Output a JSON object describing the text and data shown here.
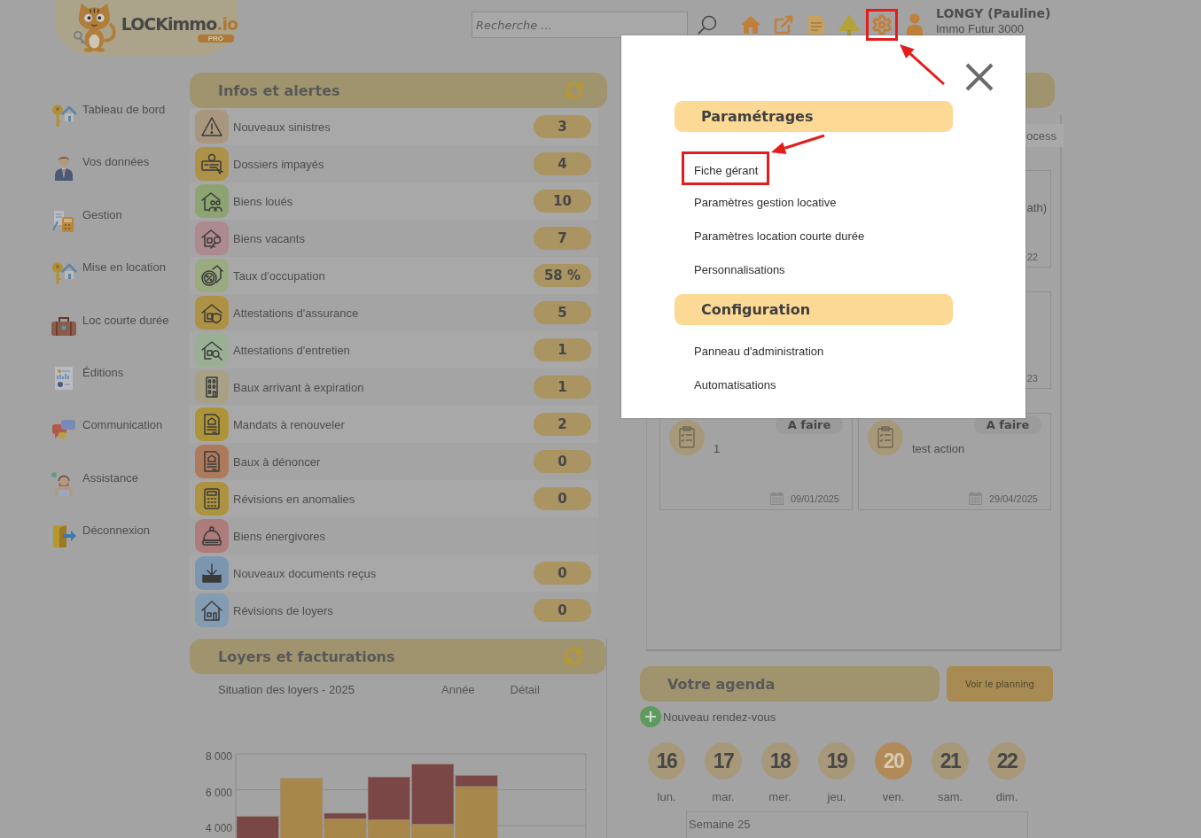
{
  "header": {
    "logo": {
      "wordmark": "LOCKimmo",
      "suffix": ".io",
      "badge": "PRO"
    },
    "search": {
      "placeholder": "Recherche ..."
    },
    "toolbar": [
      {
        "highlighted": false
      },
      {
        "highlighted": false
      },
      {
        "highlighted": false
      },
      {
        "highlighted": false
      },
      {
        "highlighted": true
      },
      {
        "highlighted": false
      }
    ],
    "user": {
      "name": "LONGY (Pauline)",
      "agency": "Immo Futur 3000"
    }
  },
  "sidebar": {
    "items": [
      {
        "label": "Tableau de bord"
      },
      {
        "label": "Vos données"
      },
      {
        "label": "Gestion"
      },
      {
        "label": "Mise en location"
      },
      {
        "label": "Loc courte durée"
      },
      {
        "label": "Éditions"
      },
      {
        "label": "Communication"
      },
      {
        "label": "Assistance"
      },
      {
        "label": "Déconnexion"
      }
    ]
  },
  "infos": {
    "title": "Infos et alertes",
    "rows": [
      {
        "label": "Nouveaux sinistres",
        "count": "3",
        "color": "#a8977e"
      },
      {
        "label": "Dossiers impayés",
        "count": "4",
        "color": "#ad9149"
      },
      {
        "label": "Biens loués",
        "count": "10",
        "color": "#8ca472"
      },
      {
        "label": "Biens vacants",
        "count": "7",
        "color": "#ad8a8f"
      },
      {
        "label": "Taux d'occupation",
        "count": "58 %",
        "color": "#9aab80"
      },
      {
        "label": "Attestations d'assurance",
        "count": "5",
        "color": "#ad9245"
      },
      {
        "label": "Attestations d'entretien",
        "count": "1",
        "color": "#9ab094"
      },
      {
        "label": "Baux arrivant à expiration",
        "count": "1",
        "color": "#a9a185"
      },
      {
        "label": "Mandats à renouveler",
        "count": "2",
        "color": "#ae9438"
      },
      {
        "label": "Baux à dénoncer",
        "count": "0",
        "color": "#ae7a5c"
      },
      {
        "label": "Révisions en anomalies",
        "count": "0",
        "color": "#ad923f"
      },
      {
        "label": "Biens énergivores",
        "color": "#ae7b7b"
      },
      {
        "label": "Nouveaux documents reçus",
        "count": "0",
        "color": "#7d96b0"
      },
      {
        "label": "Révisions de loyers",
        "count": "0",
        "color": "#849cb2"
      }
    ]
  },
  "loyers": {
    "title": "Loyers et facturations",
    "subtitle": "Situation des loyers - 2025",
    "links": [
      {
        "label": "Année"
      },
      {
        "label": "Détail"
      }
    ],
    "chart_data": {
      "type": "bar",
      "stacked": true,
      "ylim": [
        0,
        8000
      ],
      "yticks": [
        {
          "value": 4000,
          "label": "4 000"
        },
        {
          "value": 6000,
          "label": "6 000"
        },
        {
          "value": 8000,
          "label": "8 000"
        }
      ],
      "series": [
        {
          "color": "#a8884a",
          "values": [
            null,
            6630,
            4380,
            4330,
            4080,
            6180,
            null,
            null
          ]
        },
        {
          "color": "#7a4646",
          "values": [
            4510,
            null,
            310,
            2380,
            3350,
            620,
            null,
            null
          ]
        }
      ]
    }
  },
  "actions": {
    "tab": {
      "label": "ocess"
    },
    "cards": [
      {
        "title": "ath)",
        "date": "22"
      },
      {
        "date": "23"
      },
      {
        "status": "A faire",
        "title": "1",
        "date": "09/01/2025"
      },
      {
        "status": "A faire",
        "title": "test action",
        "date": "29/04/2025"
      }
    ]
  },
  "agenda": {
    "title": "Votre agenda",
    "button": "Voir le planning",
    "new_appointment": "Nouveau rendez-vous",
    "days": [
      {
        "number": "16",
        "weekday": "lun.",
        "selected": false
      },
      {
        "number": "17",
        "weekday": "mar.",
        "selected": false
      },
      {
        "number": "18",
        "weekday": "mer.",
        "selected": false
      },
      {
        "number": "19",
        "weekday": "jeu.",
        "selected": false
      },
      {
        "number": "20",
        "weekday": "ven.",
        "selected": true
      },
      {
        "number": "21",
        "weekday": "sam.",
        "selected": false
      },
      {
        "number": "22",
        "weekday": "dim.",
        "selected": false
      }
    ],
    "week": "Semaine 25"
  },
  "modal": {
    "sections": [
      {
        "title": "Paramétrages",
        "links": [
          {
            "label": "Fiche gérant",
            "highlighted": true
          },
          {
            "label": "Paramètres gestion locative",
            "highlighted": false
          },
          {
            "label": "Paramètres location courte durée",
            "highlighted": false
          },
          {
            "label": "Personnalisations",
            "highlighted": false
          }
        ]
      },
      {
        "title": "Configuration",
        "links": [
          {
            "label": "Panneau d'administration",
            "highlighted": false
          },
          {
            "label": "Automatisations",
            "highlighted": false
          }
        ]
      }
    ]
  }
}
